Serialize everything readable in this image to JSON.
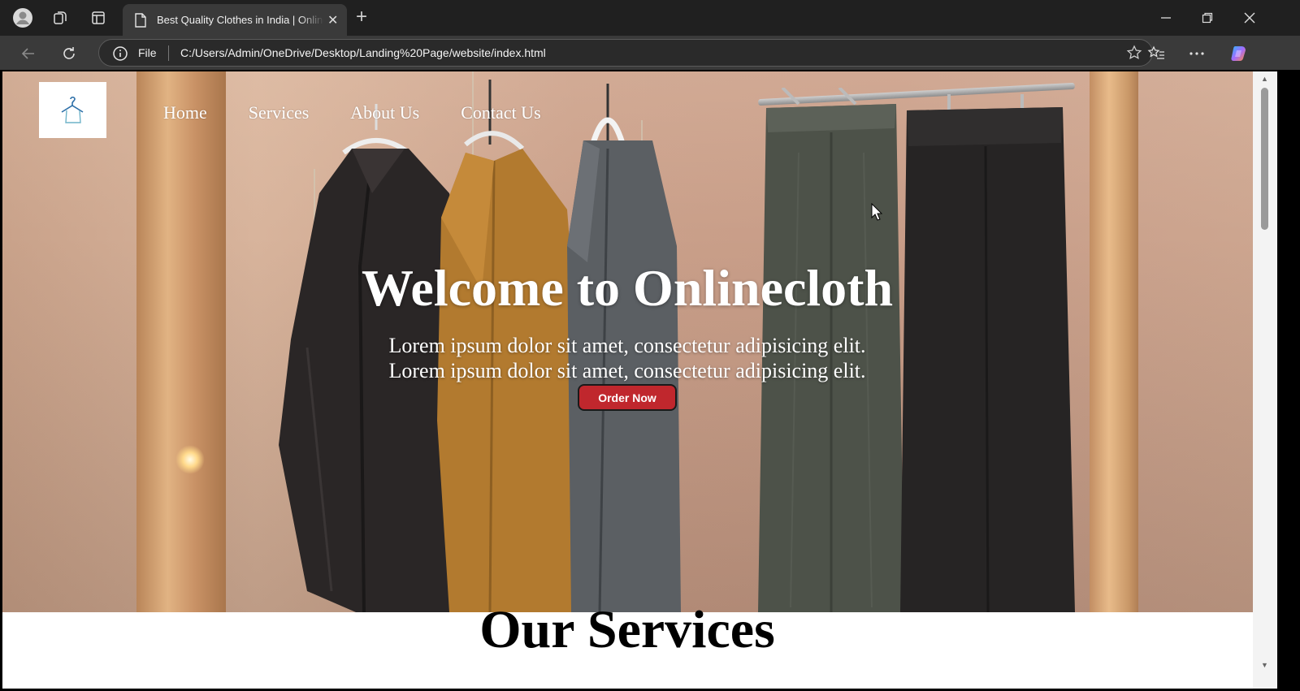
{
  "browser": {
    "tab_title": "Best Quality Clothes in India | Onlinecloth",
    "address_scheme": "File",
    "address_url": "C:/Users/Admin/OneDrive/Desktop/Landing%20Page/website/index.html",
    "icons": {
      "profile": "profile-icon",
      "workspaces": "workspaces-icon",
      "tab_actions": "tab-actions-icon",
      "new_tab": "plus-icon",
      "back": "back-arrow-icon",
      "refresh": "refresh-icon",
      "favorites": "favorites-icon",
      "more": "more-icon",
      "copilot": "copilot-icon"
    }
  },
  "page": {
    "nav": [
      {
        "label": "Home"
      },
      {
        "label": "Services"
      },
      {
        "label": "About Us"
      },
      {
        "label": "Contact Us"
      }
    ],
    "hero": {
      "title": "Welcome to Onlinecloth",
      "line1": "Lorem ipsum dolor sit amet, consectetur adipisicing elit.",
      "line2": "Lorem ipsum dolor sit amet, consectetur adipisicing elit.",
      "button": "Order Now"
    },
    "services_heading": "Our Services"
  },
  "colors": {
    "chrome_dark": "#202020",
    "chrome_bar": "#3a3a3a",
    "order_button": "#c0272d"
  }
}
